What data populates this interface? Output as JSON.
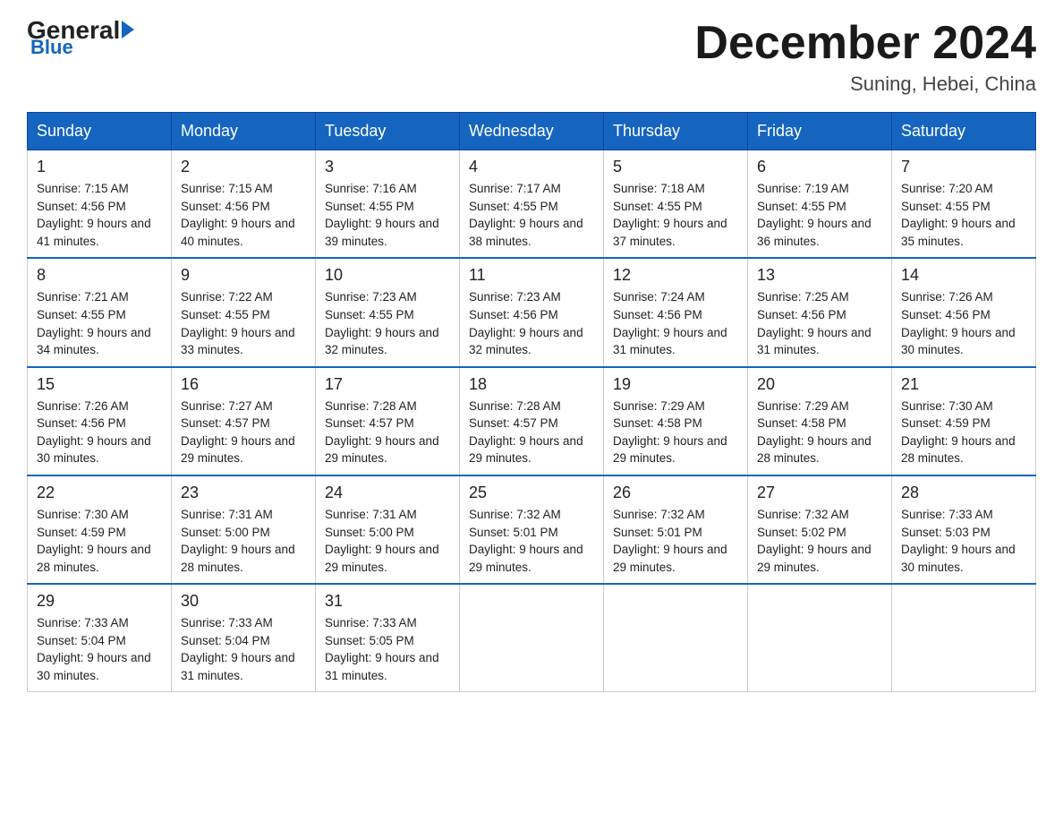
{
  "header": {
    "logo": {
      "general": "General",
      "blue": "Blue"
    },
    "title": "December 2024",
    "subtitle": "Suning, Hebei, China"
  },
  "days_of_week": [
    "Sunday",
    "Monday",
    "Tuesday",
    "Wednesday",
    "Thursday",
    "Friday",
    "Saturday"
  ],
  "weeks": [
    [
      {
        "day": "1",
        "sunrise": "7:15 AM",
        "sunset": "4:56 PM",
        "daylight": "9 hours and 41 minutes."
      },
      {
        "day": "2",
        "sunrise": "7:15 AM",
        "sunset": "4:56 PM",
        "daylight": "9 hours and 40 minutes."
      },
      {
        "day": "3",
        "sunrise": "7:16 AM",
        "sunset": "4:55 PM",
        "daylight": "9 hours and 39 minutes."
      },
      {
        "day": "4",
        "sunrise": "7:17 AM",
        "sunset": "4:55 PM",
        "daylight": "9 hours and 38 minutes."
      },
      {
        "day": "5",
        "sunrise": "7:18 AM",
        "sunset": "4:55 PM",
        "daylight": "9 hours and 37 minutes."
      },
      {
        "day": "6",
        "sunrise": "7:19 AM",
        "sunset": "4:55 PM",
        "daylight": "9 hours and 36 minutes."
      },
      {
        "day": "7",
        "sunrise": "7:20 AM",
        "sunset": "4:55 PM",
        "daylight": "9 hours and 35 minutes."
      }
    ],
    [
      {
        "day": "8",
        "sunrise": "7:21 AM",
        "sunset": "4:55 PM",
        "daylight": "9 hours and 34 minutes."
      },
      {
        "day": "9",
        "sunrise": "7:22 AM",
        "sunset": "4:55 PM",
        "daylight": "9 hours and 33 minutes."
      },
      {
        "day": "10",
        "sunrise": "7:23 AM",
        "sunset": "4:55 PM",
        "daylight": "9 hours and 32 minutes."
      },
      {
        "day": "11",
        "sunrise": "7:23 AM",
        "sunset": "4:56 PM",
        "daylight": "9 hours and 32 minutes."
      },
      {
        "day": "12",
        "sunrise": "7:24 AM",
        "sunset": "4:56 PM",
        "daylight": "9 hours and 31 minutes."
      },
      {
        "day": "13",
        "sunrise": "7:25 AM",
        "sunset": "4:56 PM",
        "daylight": "9 hours and 31 minutes."
      },
      {
        "day": "14",
        "sunrise": "7:26 AM",
        "sunset": "4:56 PM",
        "daylight": "9 hours and 30 minutes."
      }
    ],
    [
      {
        "day": "15",
        "sunrise": "7:26 AM",
        "sunset": "4:56 PM",
        "daylight": "9 hours and 30 minutes."
      },
      {
        "day": "16",
        "sunrise": "7:27 AM",
        "sunset": "4:57 PM",
        "daylight": "9 hours and 29 minutes."
      },
      {
        "day": "17",
        "sunrise": "7:28 AM",
        "sunset": "4:57 PM",
        "daylight": "9 hours and 29 minutes."
      },
      {
        "day": "18",
        "sunrise": "7:28 AM",
        "sunset": "4:57 PM",
        "daylight": "9 hours and 29 minutes."
      },
      {
        "day": "19",
        "sunrise": "7:29 AM",
        "sunset": "4:58 PM",
        "daylight": "9 hours and 29 minutes."
      },
      {
        "day": "20",
        "sunrise": "7:29 AM",
        "sunset": "4:58 PM",
        "daylight": "9 hours and 28 minutes."
      },
      {
        "day": "21",
        "sunrise": "7:30 AM",
        "sunset": "4:59 PM",
        "daylight": "9 hours and 28 minutes."
      }
    ],
    [
      {
        "day": "22",
        "sunrise": "7:30 AM",
        "sunset": "4:59 PM",
        "daylight": "9 hours and 28 minutes."
      },
      {
        "day": "23",
        "sunrise": "7:31 AM",
        "sunset": "5:00 PM",
        "daylight": "9 hours and 28 minutes."
      },
      {
        "day": "24",
        "sunrise": "7:31 AM",
        "sunset": "5:00 PM",
        "daylight": "9 hours and 29 minutes."
      },
      {
        "day": "25",
        "sunrise": "7:32 AM",
        "sunset": "5:01 PM",
        "daylight": "9 hours and 29 minutes."
      },
      {
        "day": "26",
        "sunrise": "7:32 AM",
        "sunset": "5:01 PM",
        "daylight": "9 hours and 29 minutes."
      },
      {
        "day": "27",
        "sunrise": "7:32 AM",
        "sunset": "5:02 PM",
        "daylight": "9 hours and 29 minutes."
      },
      {
        "day": "28",
        "sunrise": "7:33 AM",
        "sunset": "5:03 PM",
        "daylight": "9 hours and 30 minutes."
      }
    ],
    [
      {
        "day": "29",
        "sunrise": "7:33 AM",
        "sunset": "5:04 PM",
        "daylight": "9 hours and 30 minutes."
      },
      {
        "day": "30",
        "sunrise": "7:33 AM",
        "sunset": "5:04 PM",
        "daylight": "9 hours and 31 minutes."
      },
      {
        "day": "31",
        "sunrise": "7:33 AM",
        "sunset": "5:05 PM",
        "daylight": "9 hours and 31 minutes."
      },
      null,
      null,
      null,
      null
    ]
  ]
}
